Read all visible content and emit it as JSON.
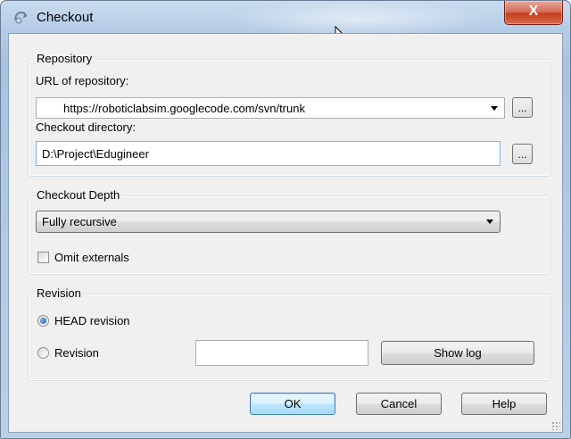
{
  "window": {
    "title": "Checkout",
    "close_label": "X"
  },
  "repository": {
    "group_label": "Repository",
    "url_label": "URL of repository:",
    "url_value": "https://roboticlabsim.googlecode.com/svn/trunk",
    "browse_label": "...",
    "dir_label": "Checkout directory:",
    "dir_value": "D:\\Project\\Edugineer"
  },
  "depth": {
    "group_label": "Checkout Depth",
    "selected": "Fully recursive",
    "omit_externals_label": "Omit externals",
    "omit_externals_checked": false
  },
  "revision": {
    "group_label": "Revision",
    "head_label": "HEAD revision",
    "head_selected": true,
    "revision_label": "Revision",
    "revision_value": "",
    "show_log_label": "Show log"
  },
  "buttons": {
    "ok": "OK",
    "cancel": "Cancel",
    "help": "Help"
  },
  "colors": {
    "accent": "#3c7fb1",
    "close_red": "#c6401f",
    "frame": "#b7cde6"
  }
}
